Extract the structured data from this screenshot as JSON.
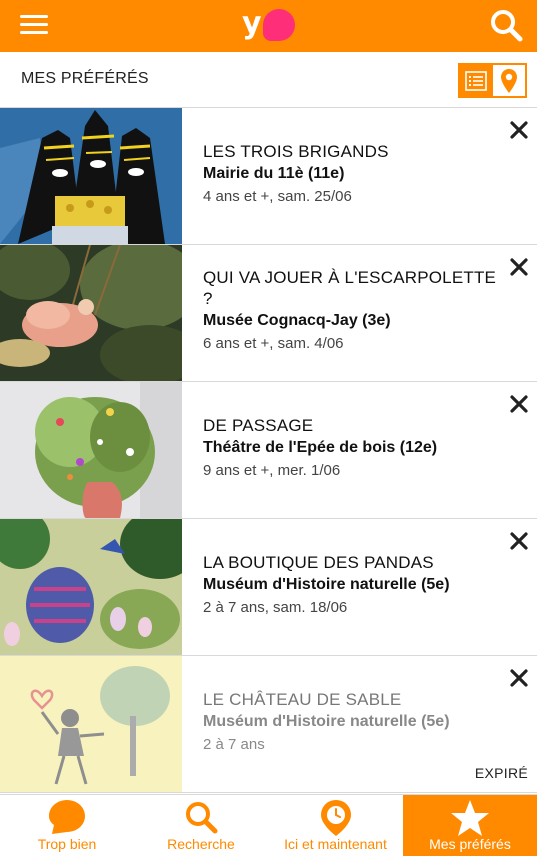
{
  "header": {
    "logo_text": "y"
  },
  "subheader": {
    "title": "MES PRÉFÉRÉS"
  },
  "items": [
    {
      "title": "LES TROIS BRIGANDS",
      "venue": "Mairie du 11è (11e)",
      "meta": "4 ans et +, sam. 25/06"
    },
    {
      "title": "QUI VA JOUER À L'ESCARPOLETTE ?",
      "venue": "Musée Cognacq-Jay (3e)",
      "meta": "6 ans et +, sam. 4/06"
    },
    {
      "title": "DE PASSAGE",
      "venue": "Théâtre de l'Epée de bois (12e)",
      "meta": "9 ans et +, mer. 1/06"
    },
    {
      "title": "LA BOUTIQUE DES PANDAS",
      "venue": "Muséum d'Histoire naturelle (5e)",
      "meta": "2 à 7 ans, sam. 18/06"
    },
    {
      "title": "LE CHÂTEAU DE SABLE",
      "venue": "Muséum d'Histoire naturelle (5e)",
      "meta": "2 à 7 ans",
      "status": "EXPIRÉ"
    }
  ],
  "nav": [
    {
      "label": "Trop bien",
      "icon": "speech-bubble-icon"
    },
    {
      "label": "Recherche",
      "icon": "search-icon"
    },
    {
      "label": "Ici et maintenant",
      "icon": "location-clock-icon"
    },
    {
      "label": "Mes préférés",
      "icon": "star-icon",
      "active": true
    }
  ],
  "colors": {
    "accent": "#ff8a00",
    "logo_dot": "#ff2e79"
  }
}
